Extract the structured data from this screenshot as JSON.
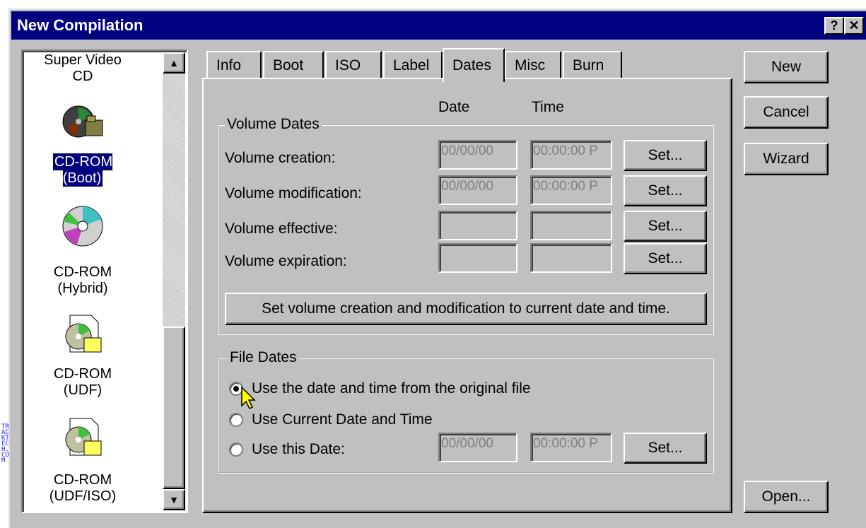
{
  "window": {
    "title": "New Compilation",
    "help_btn": "?",
    "close_btn": "✕"
  },
  "list": {
    "items": [
      {
        "label1": "Super Video",
        "label2": "CD",
        "icon": "video-cd-icon"
      },
      {
        "label1": "CD-ROM",
        "label2": "(Boot)",
        "icon": "boot-cd-icon",
        "selected": true
      },
      {
        "label1": "CD-ROM",
        "label2": "(Hybrid)",
        "icon": "hybrid-cd-icon"
      },
      {
        "label1": "CD-ROM",
        "label2": "(UDF)",
        "icon": "udf-cd-icon"
      },
      {
        "label1": "CD-ROM",
        "label2": "(UDF/ISO)",
        "icon": "udf-iso-cd-icon"
      }
    ]
  },
  "tabs": [
    {
      "label": "Info"
    },
    {
      "label": "Boot"
    },
    {
      "label": "ISO"
    },
    {
      "label": "Label"
    },
    {
      "label": "Dates",
      "active": true
    },
    {
      "label": "Misc"
    },
    {
      "label": "Burn"
    }
  ],
  "dates": {
    "col_date": "Date",
    "col_time": "Time",
    "volume_group": "Volume Dates",
    "rows": [
      {
        "label": "Volume creation:",
        "date": "00/00/00",
        "time": "00:00:00 P",
        "set": "Set..."
      },
      {
        "label": "Volume modification:",
        "date": "00/00/00",
        "time": "00:00:00 P",
        "set": "Set..."
      },
      {
        "label": "Volume effective:",
        "date": "",
        "time": "",
        "set": "Set..."
      },
      {
        "label": "Volume expiration:",
        "date": "",
        "time": "",
        "set": "Set..."
      }
    ],
    "set_current_btn": "Set volume creation and modification to current date and time.",
    "file_group": "File Dates",
    "radio_original": "Use the date and time from the original file",
    "radio_current": "Use Current Date and Time",
    "radio_this": "Use this Date:",
    "this_date": "00/00/00",
    "this_time": "00:00:00 P",
    "this_set": "Set..."
  },
  "buttons": {
    "new": "New",
    "cancel": "Cancel",
    "wizard": "Wizard",
    "open": "Open..."
  },
  "watermark": "TRACKTECH.COM"
}
